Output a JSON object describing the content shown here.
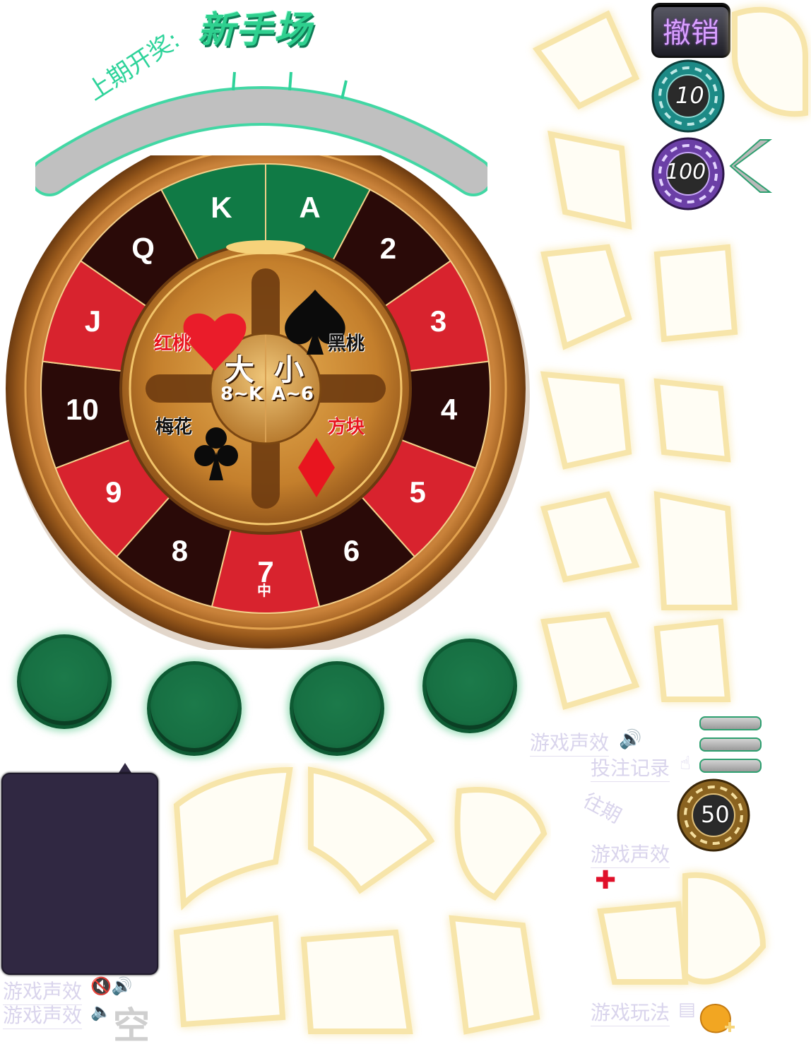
{
  "header": {
    "title": "新手场"
  },
  "last_draw": {
    "label": "上期开奖:"
  },
  "wheel": {
    "outer_slots": [
      "K",
      "A",
      "2",
      "3",
      "4",
      "5",
      "6",
      "7",
      "8",
      "9",
      "10",
      "J",
      "Q"
    ],
    "seven_sub": "中",
    "center": {
      "big": "大",
      "small": "小",
      "big_range": "8~K",
      "small_range": "A~6"
    },
    "suits": {
      "hearts": "红桃",
      "spades": "黑桃",
      "clubs": "梅花",
      "diamonds": "方块"
    }
  },
  "controls": {
    "undo_label": "撤销",
    "chip_10": "10",
    "chip_100": "100",
    "chip_50": "50"
  },
  "menu": {
    "sound_label": "游戏声效",
    "history_label": "投注记录",
    "period_label": "往期",
    "sound_label_2": "游戏声效",
    "rules_label": "游戏玩法"
  },
  "bottom_left": {
    "sound_label_a": "游戏声效",
    "sound_label_b": "游戏声效",
    "empty_label": "空"
  },
  "colors": {
    "red": "#d8232e",
    "dark": "#2a0a08",
    "green": "#107a45",
    "wood": "#b8702a",
    "gold": "#f5d77a"
  }
}
